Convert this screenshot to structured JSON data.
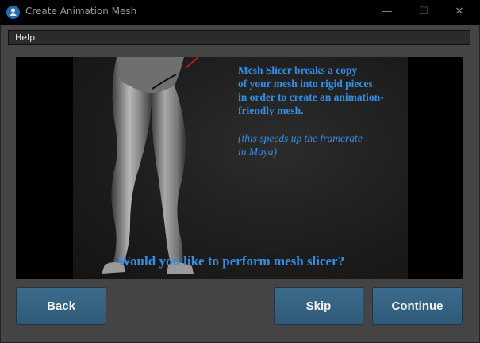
{
  "window": {
    "title": "Create Animation Mesh",
    "minimize_glyph": "—",
    "maximize_glyph": "☐",
    "close_glyph": "✕"
  },
  "menu": {
    "help": "Help"
  },
  "preview": {
    "description_lines": [
      "Mesh Slicer breaks a copy",
      "of your mesh into rigid pieces",
      "in order to create an animation-",
      "friendly mesh."
    ],
    "note_lines": [
      "(this speeds up the framerate",
      "in Maya)"
    ],
    "question": "Would you like to perform mesh slicer?"
  },
  "buttons": {
    "back": "Back",
    "skip": "Skip",
    "continue": "Continue"
  },
  "colors": {
    "accent_text": "#2f8fe6",
    "button_bg": "#35627f",
    "window_bg": "#444444"
  },
  "icons": {
    "app": "app-logo-icon",
    "slice_marker": "red-slice-line"
  }
}
